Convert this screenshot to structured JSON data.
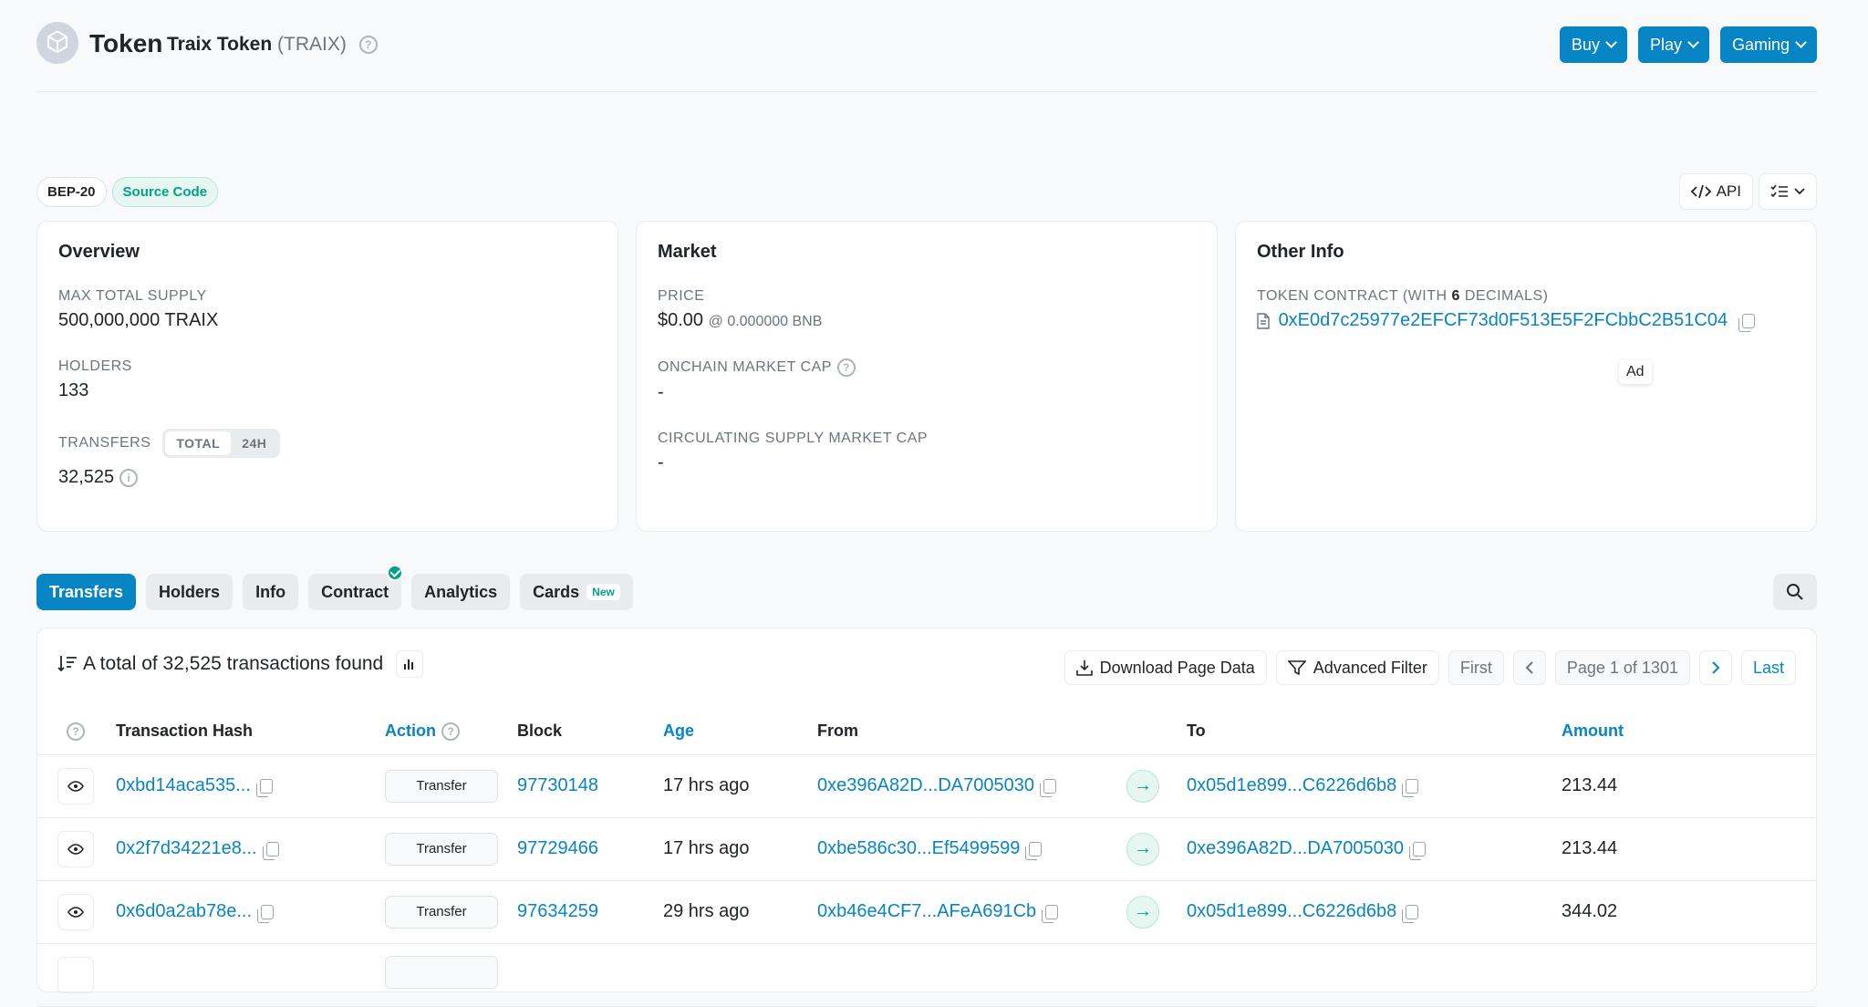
{
  "header": {
    "title": "Token",
    "token_name": "Traix Token",
    "token_symbol": "(TRAIX)",
    "buttons": [
      "Buy",
      "Play",
      "Gaming"
    ]
  },
  "badges": {
    "standard": "BEP-20",
    "source": "Source Code"
  },
  "tools": {
    "api": "API"
  },
  "overview": {
    "title": "Overview",
    "max_supply_label": "MAX TOTAL SUPPLY",
    "max_supply_value": "500,000,000 TRAIX",
    "holders_label": "HOLDERS",
    "holders_value": "133",
    "transfers_label": "TRANSFERS",
    "toggle_total": "TOTAL",
    "toggle_24h": "24H",
    "transfers_value": "32,525"
  },
  "market": {
    "title": "Market",
    "price_label": "PRICE",
    "price_value": "$0.00",
    "price_bnb": "@ 0.000000 BNB",
    "onchain_label": "ONCHAIN MARKET CAP",
    "onchain_value": "-",
    "circ_label": "CIRCULATING SUPPLY MARKET CAP",
    "circ_value": "-"
  },
  "other": {
    "title": "Other Info",
    "contract_label_prefix": "TOKEN CONTRACT (WITH ",
    "contract_decimals": "6",
    "contract_label_suffix": " DECIMALS)",
    "contract_address": "0xE0d7c25977e2EFCF73d0F513E5F2FCbbC2B51C04",
    "ad": "Ad"
  },
  "tabs": [
    "Transfers",
    "Holders",
    "Info",
    "Contract",
    "Analytics",
    "Cards"
  ],
  "tab_new": "New",
  "panel": {
    "summary": "A total of 32,525 transactions found",
    "download": "Download Page Data",
    "filter": "Advanced Filter",
    "first": "First",
    "page": "Page 1 of 1301",
    "last": "Last"
  },
  "columns": {
    "hash": "Transaction Hash",
    "action": "Action",
    "block": "Block",
    "age": "Age",
    "from": "From",
    "to": "To",
    "amount": "Amount"
  },
  "rows": [
    {
      "hash": "0xbd14aca535...",
      "action": "Transfer",
      "block": "97730148",
      "age": "17 hrs ago",
      "from": "0xe396A82D...DA7005030",
      "to": "0x05d1e899...C6226d6b8",
      "amount": "213.44"
    },
    {
      "hash": "0x2f7d34221e8...",
      "action": "Transfer",
      "block": "97729466",
      "age": "17 hrs ago",
      "from": "0xbe586c30...Ef5499599",
      "to": "0xe396A82D...DA7005030",
      "amount": "213.44"
    },
    {
      "hash": "0x6d0a2ab78e...",
      "action": "Transfer",
      "block": "97634259",
      "age": "29 hrs ago",
      "from": "0xb46e4CF7...AFeA691Cb",
      "to": "0x05d1e899...C6226d6b8",
      "amount": "344.02"
    },
    {
      "hash": "",
      "action": "",
      "block": "",
      "age": "",
      "from": "",
      "to": "",
      "amount": ""
    }
  ],
  "colors": {
    "primary": "#0784c3",
    "success": "#00a186"
  }
}
